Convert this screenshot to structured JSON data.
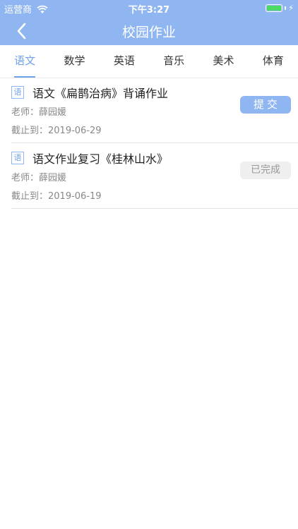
{
  "status_bar": {
    "carrier": "运营商",
    "time": "下午3:27"
  },
  "header": {
    "title": "校园作业"
  },
  "tabs": [
    {
      "label": "语文",
      "active": true
    },
    {
      "label": "数学",
      "active": false
    },
    {
      "label": "英语",
      "active": false
    },
    {
      "label": "音乐",
      "active": false
    },
    {
      "label": "美术",
      "active": false
    },
    {
      "label": "体育",
      "active": false
    }
  ],
  "assignments": [
    {
      "subject_badge": "语",
      "title": "语文《扁鹊治病》背诵作业",
      "teacher": "老师：薛园媛",
      "deadline": "截止到：2019-06-29",
      "action_label": "提交",
      "status": "pending"
    },
    {
      "subject_badge": "语",
      "title": "语文作业复习《桂林山水》",
      "teacher": "老师：薛园媛",
      "deadline": "截止到：2019-06-19",
      "action_label": "已完成",
      "status": "done"
    }
  ],
  "colors": {
    "primary": "#8fb6f0",
    "tab_active": "#6fa2ea",
    "battery": "#4cd964",
    "done_bg": "#efefef"
  }
}
